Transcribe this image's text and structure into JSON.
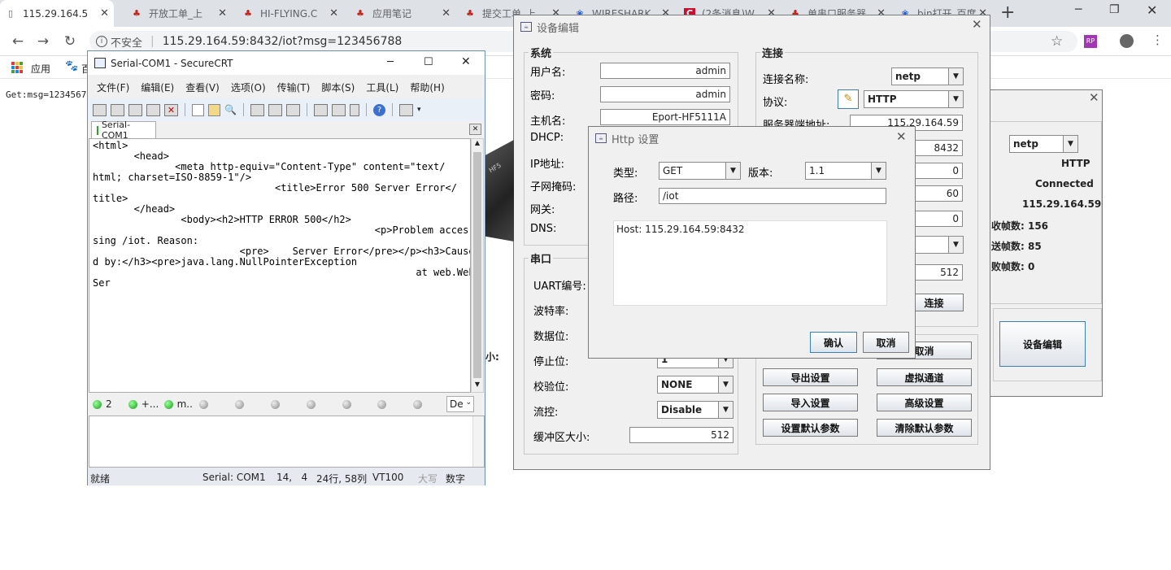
{
  "browser": {
    "tabs": [
      {
        "label": "115.29.164.5",
        "icon": "page-icon"
      },
      {
        "label": "开放工单_上",
        "icon": "maple-leaf-icon"
      },
      {
        "label": "HI-FLYING.C",
        "icon": "maple-leaf-icon"
      },
      {
        "label": "应用笔记",
        "icon": "maple-leaf-icon"
      },
      {
        "label": "提交工单_上",
        "icon": "maple-leaf-icon"
      },
      {
        "label": "WIRESHARK",
        "icon": "paw-icon"
      },
      {
        "label": "(2条消息)W",
        "icon": "c-logo-icon"
      },
      {
        "label": "单串口服务器",
        "icon": "maple-leaf-icon"
      },
      {
        "label": "bin打开_百度",
        "icon": "paw-icon"
      }
    ],
    "new_tab": "+",
    "security_label": "不安全",
    "url": "115.29.164.59:8432/iot?msg=123456788",
    "bookmark_apps": "应用",
    "bookmark_2": "百",
    "page_text": "Get:msg=1234567"
  },
  "crt": {
    "title": "Serial-COM1 - SecureCRT",
    "menu": [
      "文件(F)",
      "编辑(E)",
      "查看(V)",
      "选项(O)",
      "传输(T)",
      "脚本(S)",
      "工具(L)",
      "帮助(H)"
    ],
    "session_tab": "Serial-COM1",
    "terminal_lines": [
      "<html>",
      "       <head>",
      "              <meta http-equiv=\"Content-Type\" content=\"text/",
      "html; charset=ISO-8859-1\"/>",
      "                               <title>Error 500 Server Error</",
      "title>",
      "       </head>",
      "               <body><h2>HTTP ERROR 500</h2>",
      "                                                <p>Problem acces",
      "sing /iot. Reason:",
      "                         <pre>    Server Error</pre></p><h3>Cause",
      "d by:</h3><pre>java.lang.NullPointerException",
      "                                                       at web.Web",
      "Ser"
    ],
    "leds": [
      {
        "label": "2"
      },
      {
        "label": "+..."
      },
      {
        "label": "m.."
      },
      {
        "label": ""
      },
      {
        "label": ""
      },
      {
        "label": ""
      },
      {
        "label": ""
      },
      {
        "label": ""
      },
      {
        "label": ""
      },
      {
        "label": ""
      }
    ],
    "combo": "De",
    "status": {
      "ready": "就绪",
      "port": "Serial: COM1",
      "pos": "14,   4",
      "size": "24行, 58列",
      "term": "VT100",
      "caps": "大写",
      "num": "数字"
    }
  },
  "device_edit": {
    "title": "设备编辑",
    "system_group": "系统",
    "username_label": "用户名:",
    "username": "admin",
    "password_label": "密码:",
    "password": "admin",
    "host_label": "主机名:",
    "host": "Eport-HF5111A",
    "dhcp_label": "DHCP:",
    "ip_label": "IP地址:",
    "mask_label": "子网掩码:",
    "gw_label": "网关:",
    "dns_label": "DNS:",
    "serial_group": "串口",
    "uart_label": "UART编号:",
    "baud_label": "波特率:",
    "databits_label": "数据位:",
    "stopbits_label": "停止位:",
    "stopbits": "1",
    "parity_label": "校验位:",
    "parity": "NONE",
    "flow_label": "流控:",
    "flow": "Disable",
    "buffer_label": "缓冲区大小:",
    "buffer": "512",
    "conn_group": "连接",
    "conn_name_label": "连接名称:",
    "conn_name": "netp",
    "protocol_label": "协议:",
    "protocol": "HTTP",
    "server_label": "服务器端地址:",
    "server": "115.29.164.59",
    "port": "8432",
    "f1": "0",
    "f2": "60",
    "f3": "0",
    "f5": "512",
    "connect_btn": "连接",
    "cancel_btn": "取消",
    "export_btn": "导出设置",
    "virtual_btn": "虚拟通道",
    "import_btn": "导入设置",
    "advanced_btn": "高级设置",
    "setdefault_btn": "设置默认参数",
    "cleardefault_btn": "清除默认参数"
  },
  "bg_panel": {
    "conn": "netp",
    "proto": "HTTP",
    "state": "Connected",
    "ip": "115.29.164.59",
    "recv": "收帧数: 156",
    "send": "送帧数: 85",
    "fail": "败帧数: 0",
    "edit_btn": "设备编辑",
    "side": "小:"
  },
  "http_dialog": {
    "title": "Http 设置",
    "type_label": "类型:",
    "type": "GET",
    "version_label": "版本:",
    "version": "1.1",
    "path_label": "路径:",
    "path": "/iot",
    "headers": "Host: 115.29.164.59:8432",
    "ok_btn": "确认",
    "cancel_btn": "取消"
  }
}
